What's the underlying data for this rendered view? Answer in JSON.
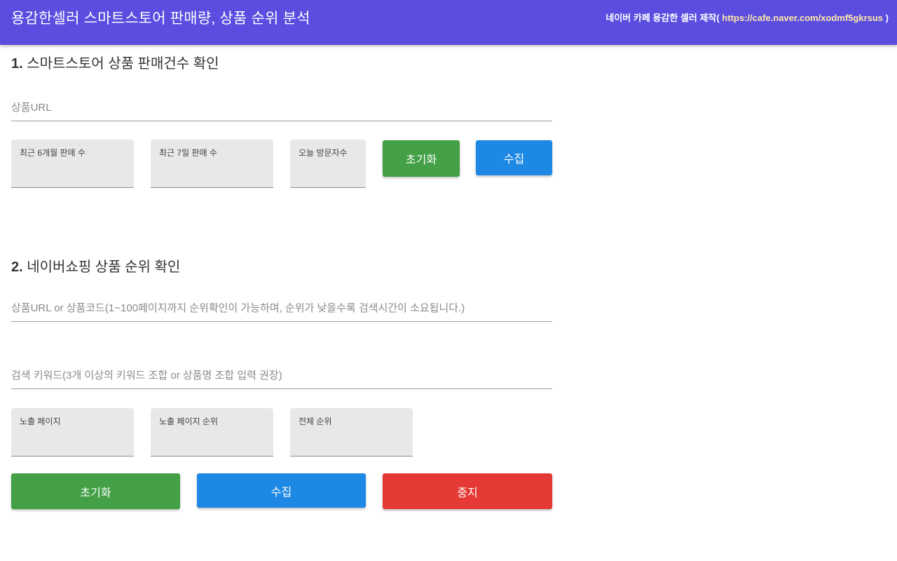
{
  "header": {
    "title": "용감한셀러 스마트스토어 판매량, 상품 순위 분석",
    "credit_prefix": "네이버 카페 용감한 셀러 제작(",
    "credit_url": " https://cafe.naver.com/xodmf5gkrsus ",
    "credit_suffix": ")",
    "colors": {
      "background": "#5a4de0",
      "url_text": "#ffe9a8"
    }
  },
  "section1": {
    "number": "1.",
    "title": " 스마트스토어 상품 판매건수 확인",
    "url_input": {
      "placeholder": "상품URL",
      "value": ""
    },
    "fields": [
      {
        "label": "최근 6개월 판매 수",
        "value": ""
      },
      {
        "label": "최근 7일 판매 수",
        "value": ""
      },
      {
        "label": "오늘 방문자수",
        "value": ""
      }
    ],
    "reset_label": "초기화",
    "collect_label": "수집"
  },
  "section2": {
    "number": "2.",
    "title": " 네이버쇼핑 상품 순위 확인",
    "url_input": {
      "placeholder": "상품URL or 상품코드(1~100페이지까지 순위확인이 가능하며, 순위가 낮을수록 검색시간이 소요됩니다.)",
      "value": ""
    },
    "keyword_input": {
      "placeholder": "검색 키워드(3개 이상의 키워드 조합 or 상품명 조합 입력 권장)",
      "value": ""
    },
    "fields": [
      {
        "label": "노출 페이지",
        "value": ""
      },
      {
        "label": "노출 페이지 순위",
        "value": ""
      },
      {
        "label": "전체 순위",
        "value": ""
      }
    ],
    "reset_label": "초기화",
    "collect_label": "수집",
    "stop_label": "중지"
  },
  "colors": {
    "green": "#43a047",
    "blue": "#1e88e5",
    "red": "#e53935"
  }
}
